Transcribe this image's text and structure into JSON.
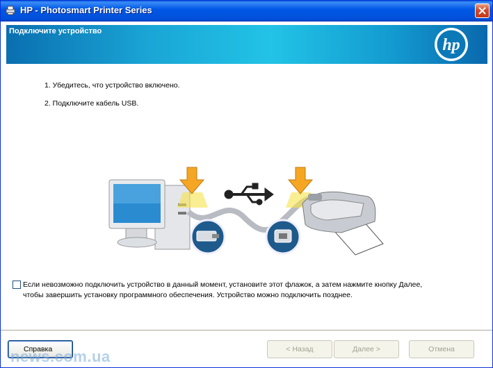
{
  "window": {
    "title": "HP - Photosmart Printer Series",
    "header_title": "Подключите устройство",
    "brand_logo": "hp"
  },
  "steps": [
    "1. Убедитесь, что устройство включено.",
    "2. Подключите кабель USB."
  ],
  "illustration": {
    "description_icons": [
      "computer-icon",
      "usb-symbol-icon",
      "printer-icon",
      "usb-plug-icon"
    ]
  },
  "checkbox": {
    "checked": false,
    "label": "Если невозможно подключить устройство в данный момент, установите этот флажок, а затем нажмите кнопку Далее, чтобы завершить установку программного обеспечения. Устройство можно подключить позднее."
  },
  "buttons": {
    "help": "Справка",
    "back": "< Назад",
    "next": "Далее >",
    "cancel": "Отмена"
  },
  "watermark": "news.com.ua",
  "colors": {
    "titlebar": "#0058e6",
    "header_band": "#22c3e6",
    "arrow": "#f5a623"
  }
}
